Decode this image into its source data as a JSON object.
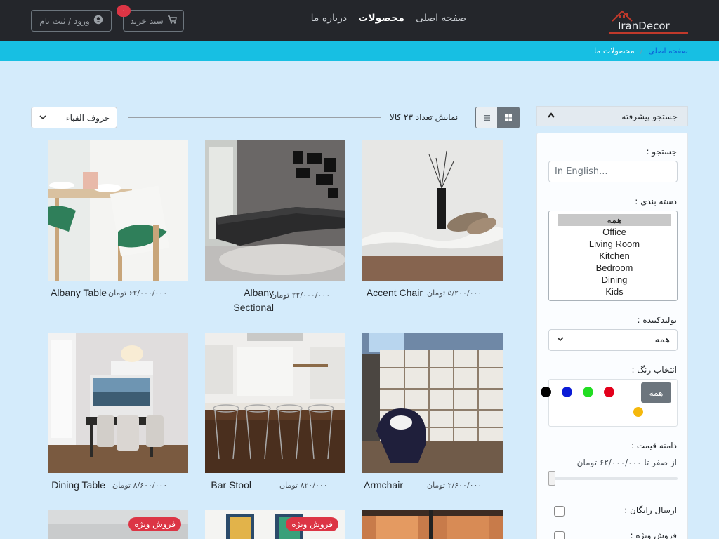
{
  "brand": {
    "logo_text": "IranDecor"
  },
  "nav": {
    "links": [
      {
        "label": "صفحه اصلی"
      },
      {
        "label": "محصولات"
      },
      {
        "label": "درباره ما"
      }
    ],
    "cart_label": "سبد خرید",
    "cart_count": "۰",
    "login_label": "ورود / ثبت نام"
  },
  "breadcrumb": {
    "home": "صفحه اصلی",
    "separator": "/",
    "current": "محصولات ما"
  },
  "sidebar": {
    "header": "جستجو پیشرفته",
    "search_label": "جستجو :",
    "search_placeholder": "In English...",
    "category_label": "دسته بندی :",
    "categories": [
      "همه",
      "Office",
      "Living Room",
      "Kitchen",
      "Bedroom",
      "Dining",
      "Kids"
    ],
    "manufacturer_label": "تولیدکننده :",
    "manufacturer_value": "همه",
    "color_label": "انتخاب رنگ :",
    "color_all": "همه",
    "colors": [
      "#e3001b",
      "#22dd22",
      "#0b1bd6",
      "#000000",
      "#f5b80c"
    ],
    "price_label": "دامنه قیمت :",
    "price_range": "از صفر تا ۶۲/۰۰۰/۰۰۰ تومان",
    "price_value_fraction": 0,
    "free_shipping_label": "ارسال رایگان :",
    "on_sale_label": "فروش ویژه :"
  },
  "toolbar": {
    "count_text": "نمایش تعداد ۲۳ کالا",
    "sort_value": "حروف الفباء"
  },
  "products": [
    {
      "title": "Accent Chair",
      "price": "۵/۲۰۰/۰۰۰ تومان"
    },
    {
      "title": "Albany Sectional",
      "price": "۲۲/۰۰۰/۰۰۰ تومان"
    },
    {
      "title": "Albany Table",
      "price": "۶۲/۰۰۰/۰۰۰ تومان"
    },
    {
      "title": "Armchair",
      "price": "۲/۶۰۰/۰۰۰ تومان"
    },
    {
      "title": "Bar Stool",
      "price": "۸۲۰/۰۰۰ تومان"
    },
    {
      "title": "Dining Table",
      "price": "۸/۶۰۰/۰۰۰ تومان"
    }
  ],
  "sale_badge": "فروش ویژه"
}
